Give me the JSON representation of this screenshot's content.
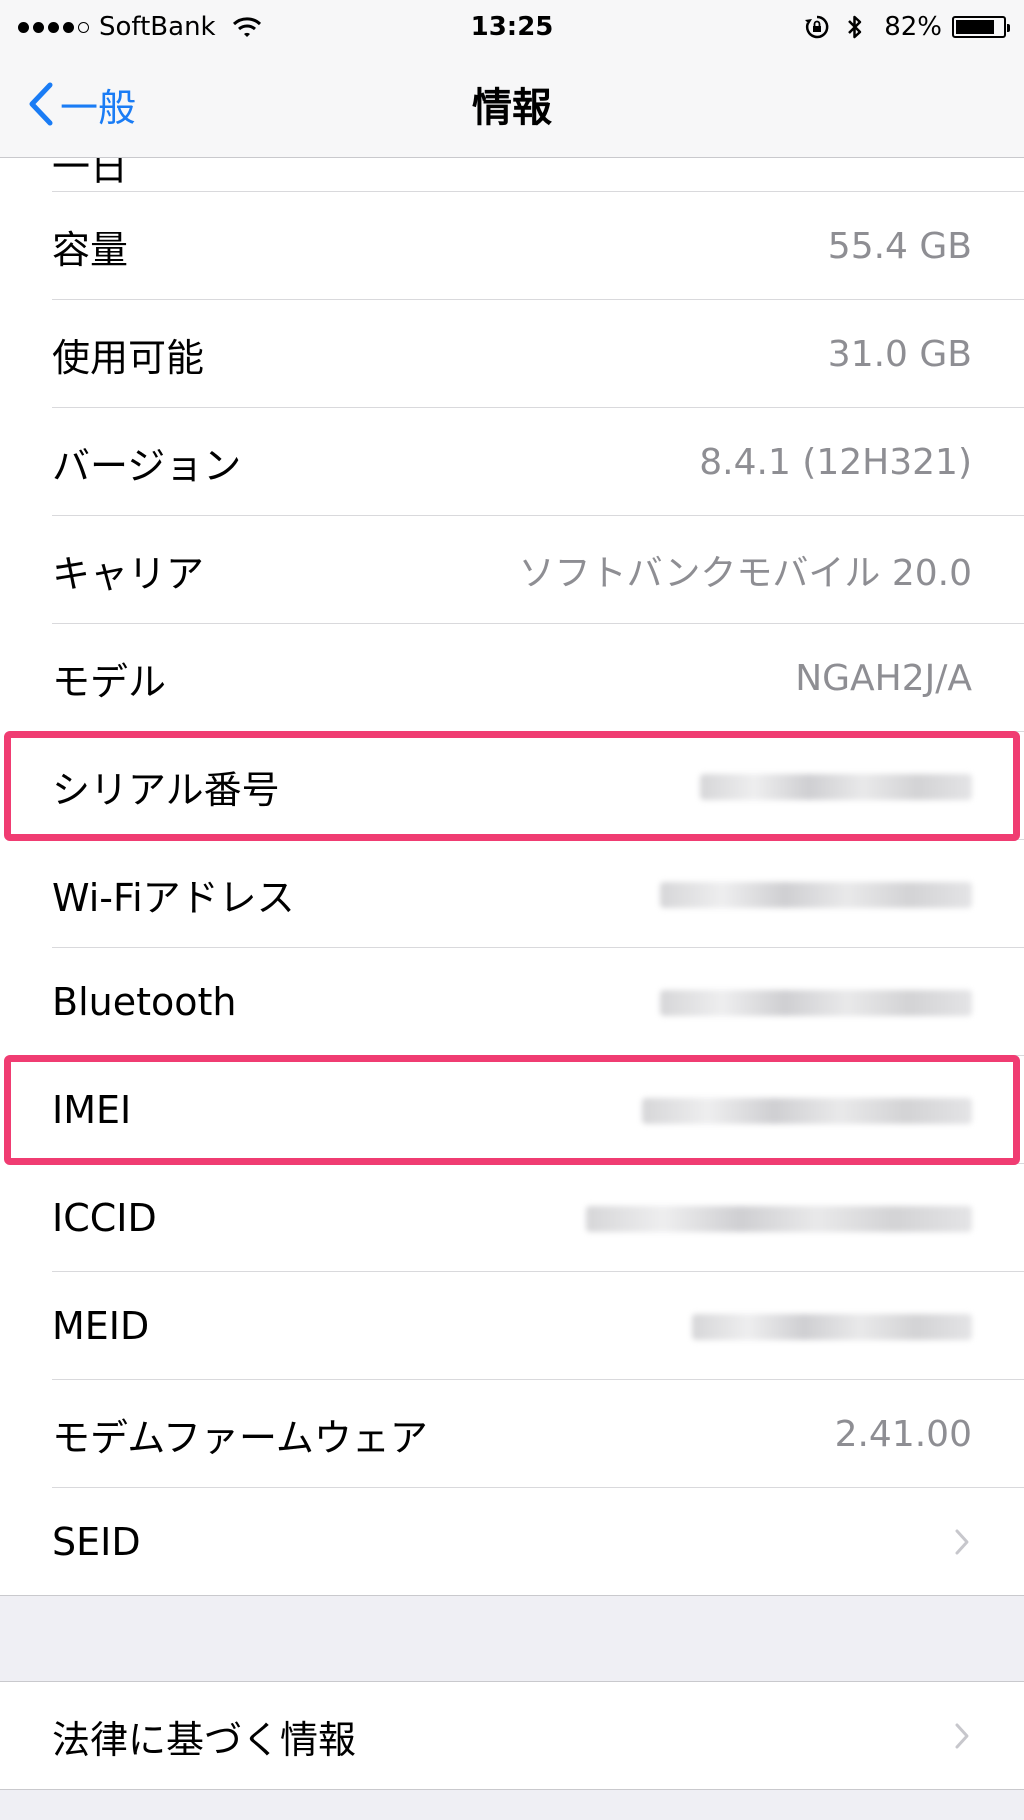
{
  "status_bar": {
    "carrier": "SoftBank",
    "time": "13:25",
    "battery_percent": "82%",
    "battery_level": 0.82,
    "icons": [
      "signal-dots",
      "wifi-icon",
      "orientation-lock-icon",
      "bluetooth-icon",
      "battery-icon"
    ]
  },
  "nav": {
    "back_label": "一般",
    "title": "情報"
  },
  "rows": [
    {
      "label": "容量",
      "value": "55.4 GB"
    },
    {
      "label": "使用可能",
      "value": "31.0 GB"
    },
    {
      "label": "バージョン",
      "value": "8.4.1 (12H321)"
    },
    {
      "label": "キャリア",
      "value": "ソフトバンクモバイル 20.0"
    },
    {
      "label": "モデル",
      "value": "NGAH2J/A"
    },
    {
      "label": "シリアル番号",
      "value": "",
      "blurred": true,
      "highlighted": true
    },
    {
      "label": "Wi-Fiアドレス",
      "value": "",
      "blurred": true
    },
    {
      "label": "Bluetooth",
      "value": "",
      "blurred": true
    },
    {
      "label": "IMEI",
      "value": "",
      "blurred": true,
      "highlighted": true
    },
    {
      "label": "ICCID",
      "value": "",
      "blurred": true
    },
    {
      "label": "MEID",
      "value": "",
      "blurred": true
    },
    {
      "label": "モデムファームウェア",
      "value": "2.41.00"
    },
    {
      "label": "SEID",
      "value": "",
      "chevron": true
    }
  ],
  "legal_row": {
    "label": "法律に基づく情報"
  },
  "colors": {
    "accent": "#1a7cf5",
    "highlight": "#f03c72",
    "secondary_text": "#8e8e93",
    "group_background": "#efeff4"
  }
}
